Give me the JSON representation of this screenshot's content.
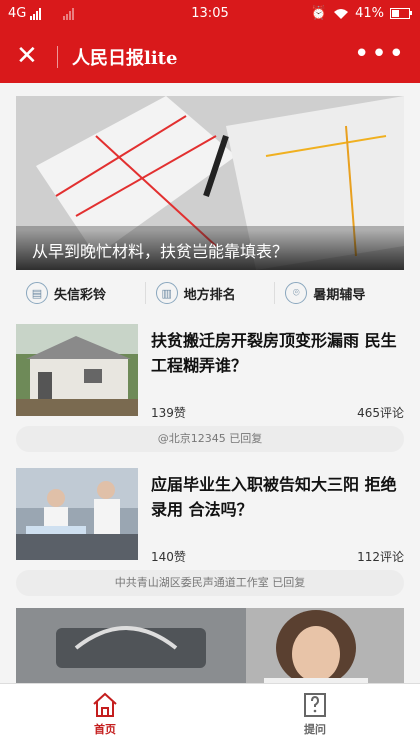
{
  "status": {
    "network": "4G",
    "time": "13:05",
    "battery": "41%",
    "battery_level": 0.41
  },
  "header": {
    "title": "人民日报lite"
  },
  "hero": {
    "caption": "从早到晚忙材料，扶贫岂能靠填表？"
  },
  "categories": [
    {
      "label": "失信彩铃",
      "icon": "document-icon"
    },
    {
      "label": "地方排名",
      "icon": "bar-chart-icon"
    },
    {
      "label": "暑期辅导",
      "icon": "location-pin-icon"
    }
  ],
  "articles": [
    {
      "title": "扶贫搬迁房开裂房顶变形漏雨 民生工程糊弄谁？",
      "likes": "139赞",
      "comments": "465评论",
      "reply": "@北京12345 已回复"
    },
    {
      "title": "应届毕业生入职被告知大三阳 拒绝录用 合法吗？",
      "likes": "140赞",
      "comments": "112评论",
      "reply": "中共青山湖区委民声通道工作室 已回复"
    }
  ],
  "tabs": [
    {
      "label": "首页",
      "active": true
    },
    {
      "label": "提问",
      "active": false
    }
  ],
  "colors": {
    "brand": "#d9191b",
    "active_tab": "#c41e1e",
    "inactive_tab": "#666666"
  }
}
